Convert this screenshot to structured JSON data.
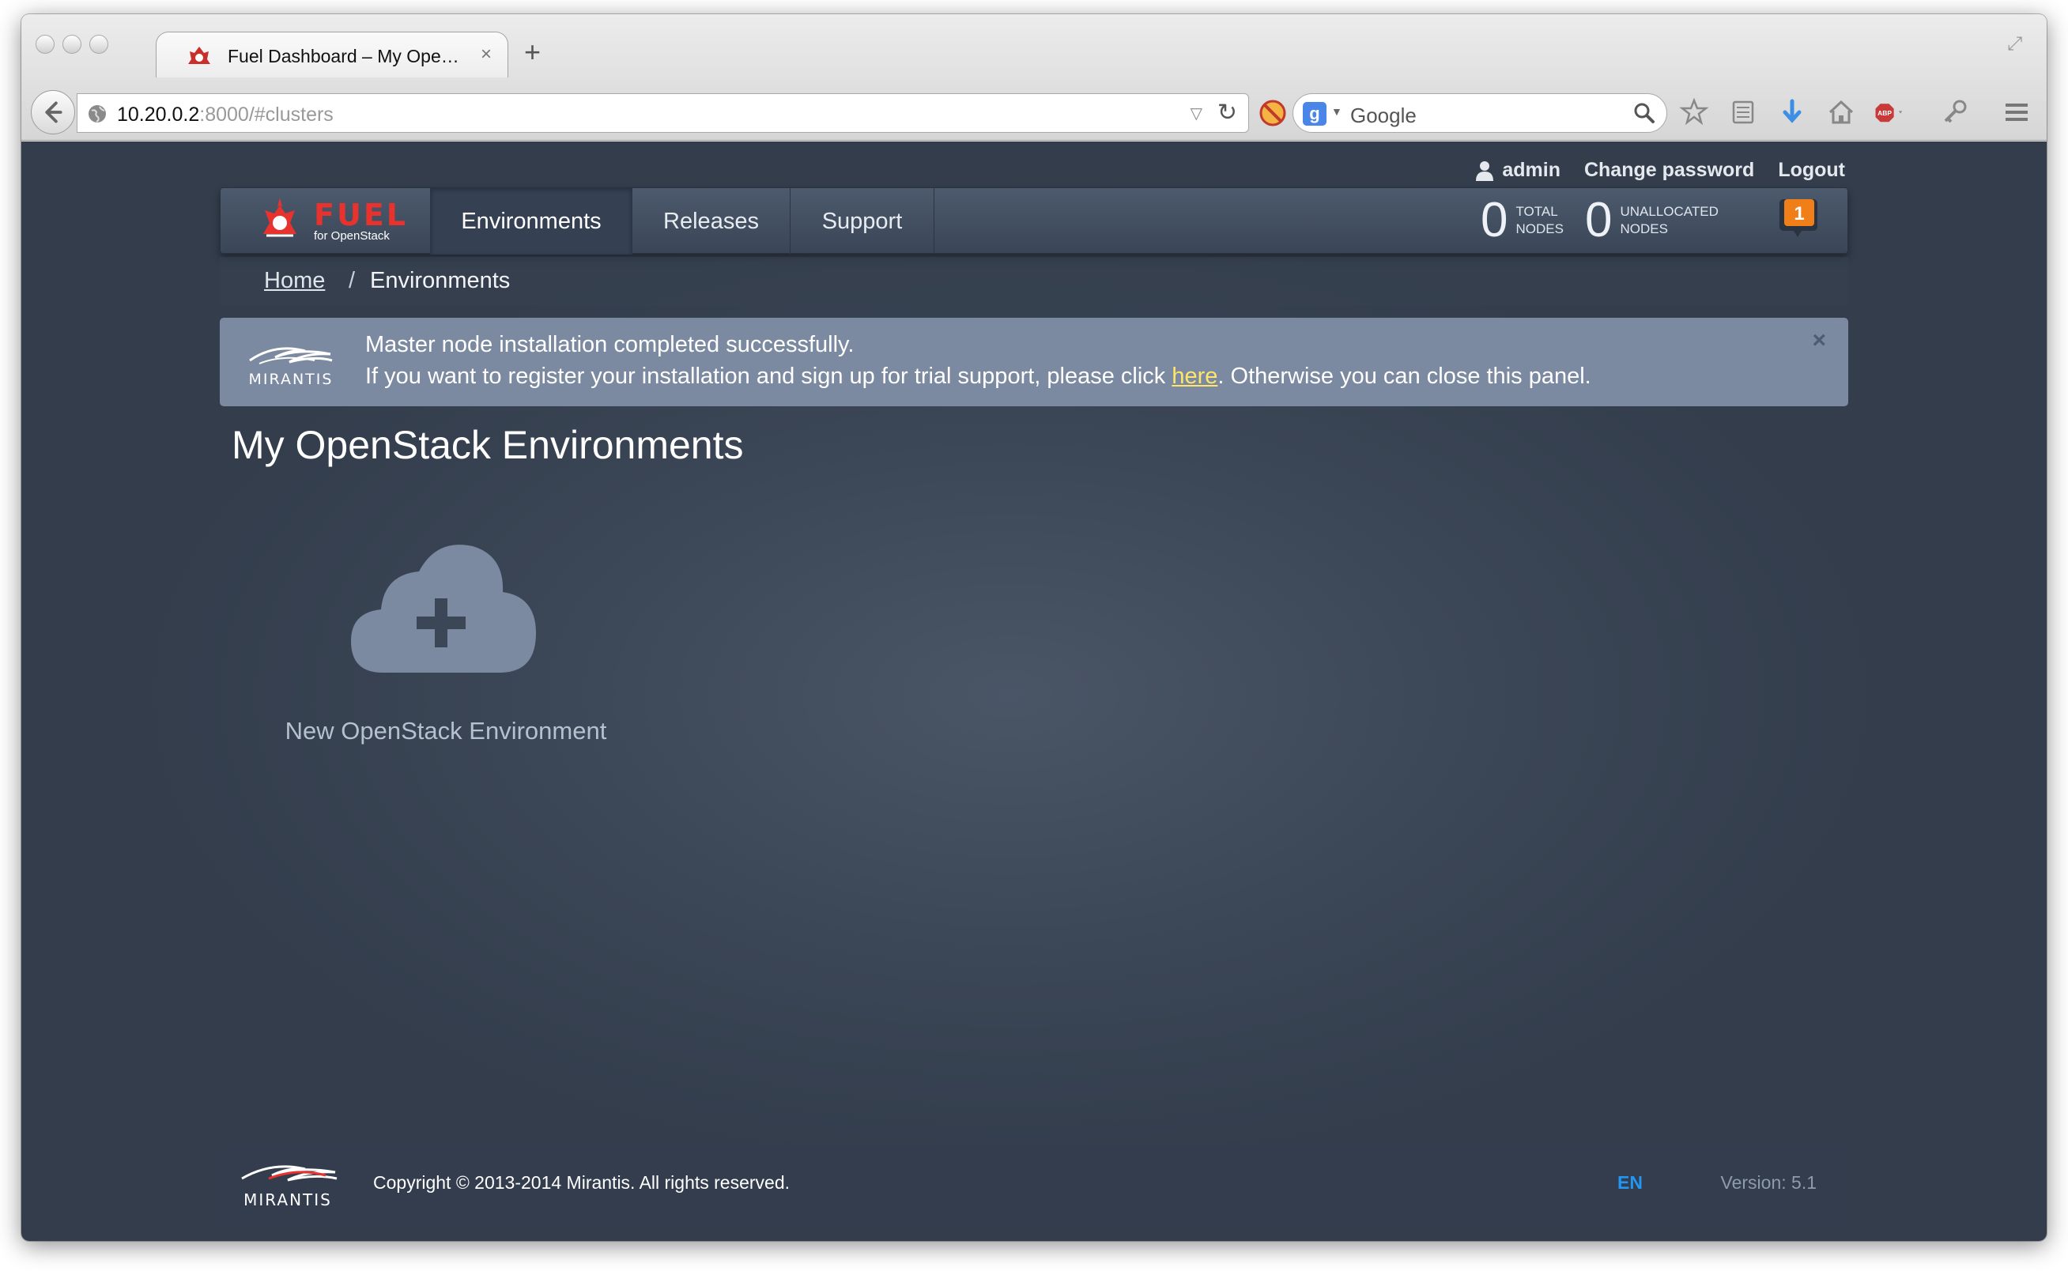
{
  "browser": {
    "tab_title": "Fuel Dashboard – My Ope…",
    "tab_close": "×",
    "new_tab": "+",
    "url_host": "10.20.0.2",
    "url_rest": ":8000/#clusters",
    "search_placeholder": "Google",
    "search_engine_letter": "g"
  },
  "userbar": {
    "username": "admin",
    "change_password": "Change password",
    "logout": "Logout"
  },
  "navbar": {
    "brand_name": "FUEL",
    "brand_sub": "for OpenStack",
    "items": [
      {
        "label": "Environments",
        "active": true
      },
      {
        "label": "Releases",
        "active": false
      },
      {
        "label": "Support",
        "active": false
      }
    ],
    "total_nodes": {
      "count": "0",
      "label_1": "TOTAL",
      "label_2": "NODES"
    },
    "unallocated_nodes": {
      "count": "0",
      "label_1": "UNALLOCATED",
      "label_2": "NODES"
    },
    "notifications_count": "1"
  },
  "breadcrumb": {
    "home": "Home",
    "separator": "/",
    "current": "Environments"
  },
  "alert": {
    "line1": "Master node installation completed successfully.",
    "line2_before": "If you want to register your installation and sign up for trial support, please click ",
    "line2_link": "here",
    "line2_after": ". Otherwise you can close this panel.",
    "close": "×",
    "logo_text": "MIRANTIS"
  },
  "main": {
    "title": "My OpenStack Environments",
    "new_env_label": "New OpenStack Environment"
  },
  "footer": {
    "logo_text": "MIRANTIS",
    "copyright": "Copyright © 2013-2014 Mirantis. All rights reserved.",
    "language": "EN",
    "version": "Version: 5.1"
  },
  "colors": {
    "brand_red": "#e8322d",
    "page_bg": "#3b4656",
    "alert_bg": "#7b8aa0",
    "link_yellow": "#ffe66b",
    "lang_blue": "#2196f3",
    "notification_orange": "#f07f1a"
  }
}
